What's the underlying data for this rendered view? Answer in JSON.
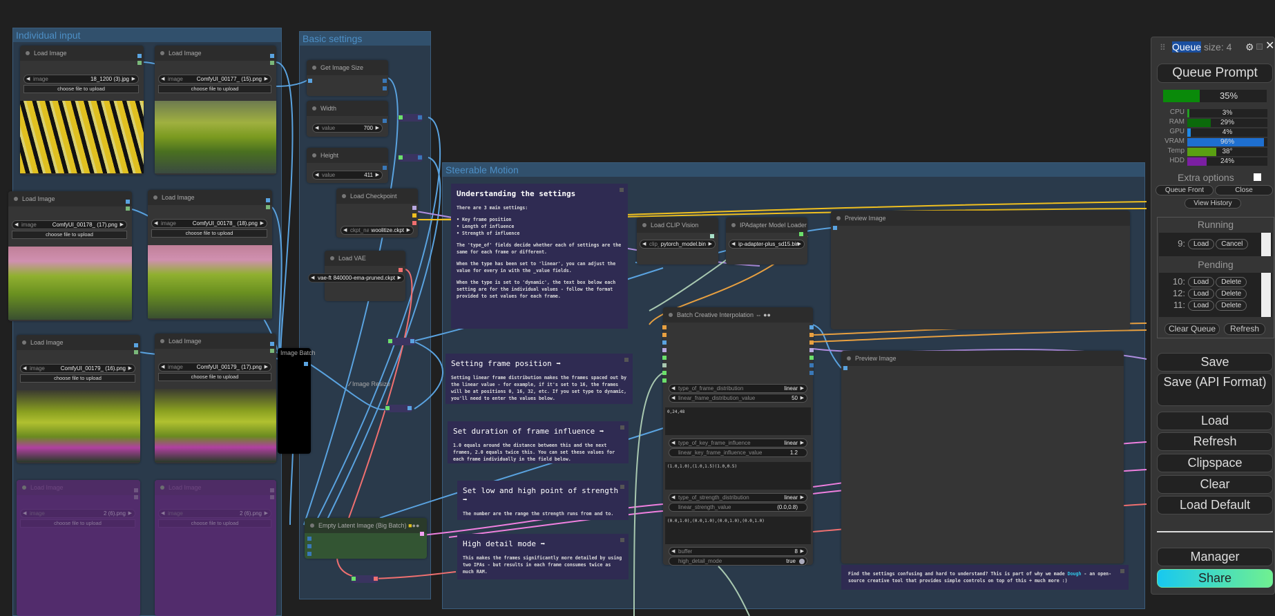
{
  "groups": {
    "individual": "Individual input",
    "basic": "Basic settings",
    "steerable": "Steerable Motion"
  },
  "load_images": [
    {
      "title": "Load Image",
      "label": "image",
      "value": "18_1200 (3).jpg",
      "upload": "choose file to upload",
      "thumb": "caterpillar"
    },
    {
      "title": "Load Image",
      "label": "image",
      "value": "ComfyUI_00177_ (15).png",
      "upload": "choose file to upload",
      "thumb": "terraces"
    },
    {
      "title": "Load Image",
      "label": "image",
      "value": "ComfyUI_00178_ (17).png",
      "upload": "choose file to upload",
      "thumb": "terraces-pink"
    },
    {
      "title": "Load Image",
      "label": "image",
      "value": "ComfyUI_00178_ (18).png",
      "upload": "choose file to upload",
      "thumb": "terraces-pink"
    },
    {
      "title": "Load Image",
      "label": "image",
      "value": "ComfyUI_00179_ (16).png",
      "upload": "choose file to upload",
      "thumb": "cottage"
    },
    {
      "title": "Load Image",
      "label": "image",
      "value": "ComfyUI_00179_ (17).png",
      "upload": "choose file to upload",
      "thumb": "cottage"
    },
    {
      "title": "Load Image",
      "label": "image",
      "value": "2 (6).png",
      "upload": "choose file to upload",
      "thumb": "",
      "bypassed": true
    },
    {
      "title": "Load Image",
      "label": "image",
      "value": "2 (6).png",
      "upload": "choose file to upload",
      "thumb": "",
      "bypassed": true
    }
  ],
  "image_batch": {
    "title": "Image Batch"
  },
  "basic": {
    "get_image_size": {
      "title": "Get Image Size"
    },
    "width": {
      "title": "Width",
      "label": "value",
      "value": "700"
    },
    "height": {
      "title": "Height",
      "label": "value",
      "value": "411"
    },
    "checkpoint": {
      "title": "Load Checkpoint",
      "label": "ckpt_nam",
      "value": "woolitize.ckpt"
    },
    "vae": {
      "title": "Load VAE",
      "label": "vae-ft-mse-",
      "value": "840000-ema-pruned.ckpt"
    },
    "image_resize": {
      "title": "Image Resize"
    },
    "empty_latent": {
      "title": "Empty Latent Image (Big Batch)"
    }
  },
  "notes": {
    "understanding": {
      "title": "Understanding the settings",
      "intro": "There are 3 main settings:",
      "bullets": [
        "• Key frame position",
        "• Length of influence",
        "• Strength of influence"
      ],
      "p1": "The 'type_of' fields decide whether each of settings are the same for each frame or different.",
      "p2": "When the type has been set to 'linear', you can adjust the value for every in with the _value fields.",
      "p3": "When the type is set to 'dynamic', the text box below each setting are for the individual values - follow the format provided to set values for each frame."
    },
    "frame_position": {
      "title": "Setting frame position ➡",
      "body": "Setting linear frame distribution makes the frames spaced out by the linear value - for example, if it's set to 16, the frames will be at positions 0, 16, 32, etc. If you set type to dynamic, you'll need to enter the values below."
    },
    "duration": {
      "title": "Set duration of frame influence ➡",
      "body": "1.0 equals around the distance between this and the next frames, 2.0 equals twice this. You can set these values for each frame individually in the field below."
    },
    "strength": {
      "title": "Set low and high point of strength ➡",
      "body": "The number are the range the strength runs from and to."
    },
    "high_detail": {
      "title": "High detail mode ➡",
      "body": "This makes the frames significantly more detailed by using two IPAs - but results in each frame consumes twice as much RAM."
    },
    "dough": {
      "before": "Find the settings confusing and hard to understand? This is part of why we made ",
      "link": "Dough",
      "after": " - an open-source creative tool that provides simple controls on top of this + much more :)"
    }
  },
  "clip_vision": {
    "title": "Load CLIP Vision",
    "label": "clip_",
    "value": "pytorch_model.bin"
  },
  "ipadapter": {
    "title": "IPAdapter Model Loader",
    "value": "ip-adapter-plus_sd15.bin"
  },
  "preview1": {
    "title": "Preview Image"
  },
  "preview2": {
    "title": "Preview Image"
  },
  "interp": {
    "title": "Batch Creative Interpolation",
    "type_of_frame_distribution": {
      "label": "type_of_frame_distribution",
      "value": "linear"
    },
    "linear_frame_distribution_value": {
      "label": "linear_frame_distribution_value",
      "value": "50"
    },
    "dynamic_frame_distribution_values": "0,24,48",
    "type_of_key_frame_influence": {
      "label": "type_of_key_frame_influence",
      "value": "linear"
    },
    "linear_key_frame_influence_value": {
      "label": "linear_key_frame_influence_value",
      "value": "1.2"
    },
    "dynamic_key_frame_influence_values": "(1.0,1.0),(1.0,1.5)(1.0,0.5)",
    "type_of_strength_distribution": {
      "label": "type_of_strength_distribution",
      "value": "linear"
    },
    "linear_strength_value": {
      "label": "linear_strength_value",
      "value": "(0.0,0.8)"
    },
    "dynamic_strength_values": "(0.0,1.0),(0.0,1.0),(0.0,1.0),(0.0,1.0)",
    "buffer": {
      "label": "buffer",
      "value": "8"
    },
    "high_detail_mode": {
      "label": "high_detail_mode",
      "value": "true"
    }
  },
  "queue": {
    "title_highlight": "Queue",
    "title_rest": "size: 4",
    "queue_prompt": "Queue Prompt",
    "progress": {
      "value": "35%",
      "fraction": 0.35,
      "color": "#0a8a0a"
    },
    "stats": [
      {
        "label": "CPU",
        "value": "3%",
        "fraction": 0.03,
        "color": "#22a022"
      },
      {
        "label": "RAM",
        "value": "29%",
        "fraction": 0.29,
        "color": "#0b6a0b"
      },
      {
        "label": "GPU",
        "value": "4%",
        "fraction": 0.04,
        "color": "#1e88e5"
      },
      {
        "label": "VRAM",
        "value": "96%",
        "fraction": 0.96,
        "color": "#1e6fd0"
      },
      {
        "label": "Temp",
        "value": "38°",
        "fraction": 0.36,
        "color": "#5aa012"
      },
      {
        "label": "HDD",
        "value": "24%",
        "fraction": 0.24,
        "color": "#7b1fa2"
      }
    ],
    "extra_options": "Extra options",
    "extra_options_checked": false,
    "queue_front": "Queue Front",
    "close": "Close",
    "view_history": "View History",
    "running_title": "Running",
    "running": [
      {
        "num": "9:",
        "load": "Load",
        "action": "Cancel"
      }
    ],
    "pending_title": "Pending",
    "pending": [
      {
        "num": "10:",
        "load": "Load",
        "action": "Delete"
      },
      {
        "num": "12:",
        "load": "Load",
        "action": "Delete"
      },
      {
        "num": "11:",
        "load": "Load",
        "action": "Delete"
      }
    ],
    "clear_queue": "Clear Queue",
    "refresh_list": "Refresh",
    "buttons": [
      "Save",
      "Save (API Format)",
      "Load",
      "Refresh",
      "Clipspace",
      "Clear",
      "Load Default"
    ],
    "manager": "Manager",
    "share": "Share"
  }
}
